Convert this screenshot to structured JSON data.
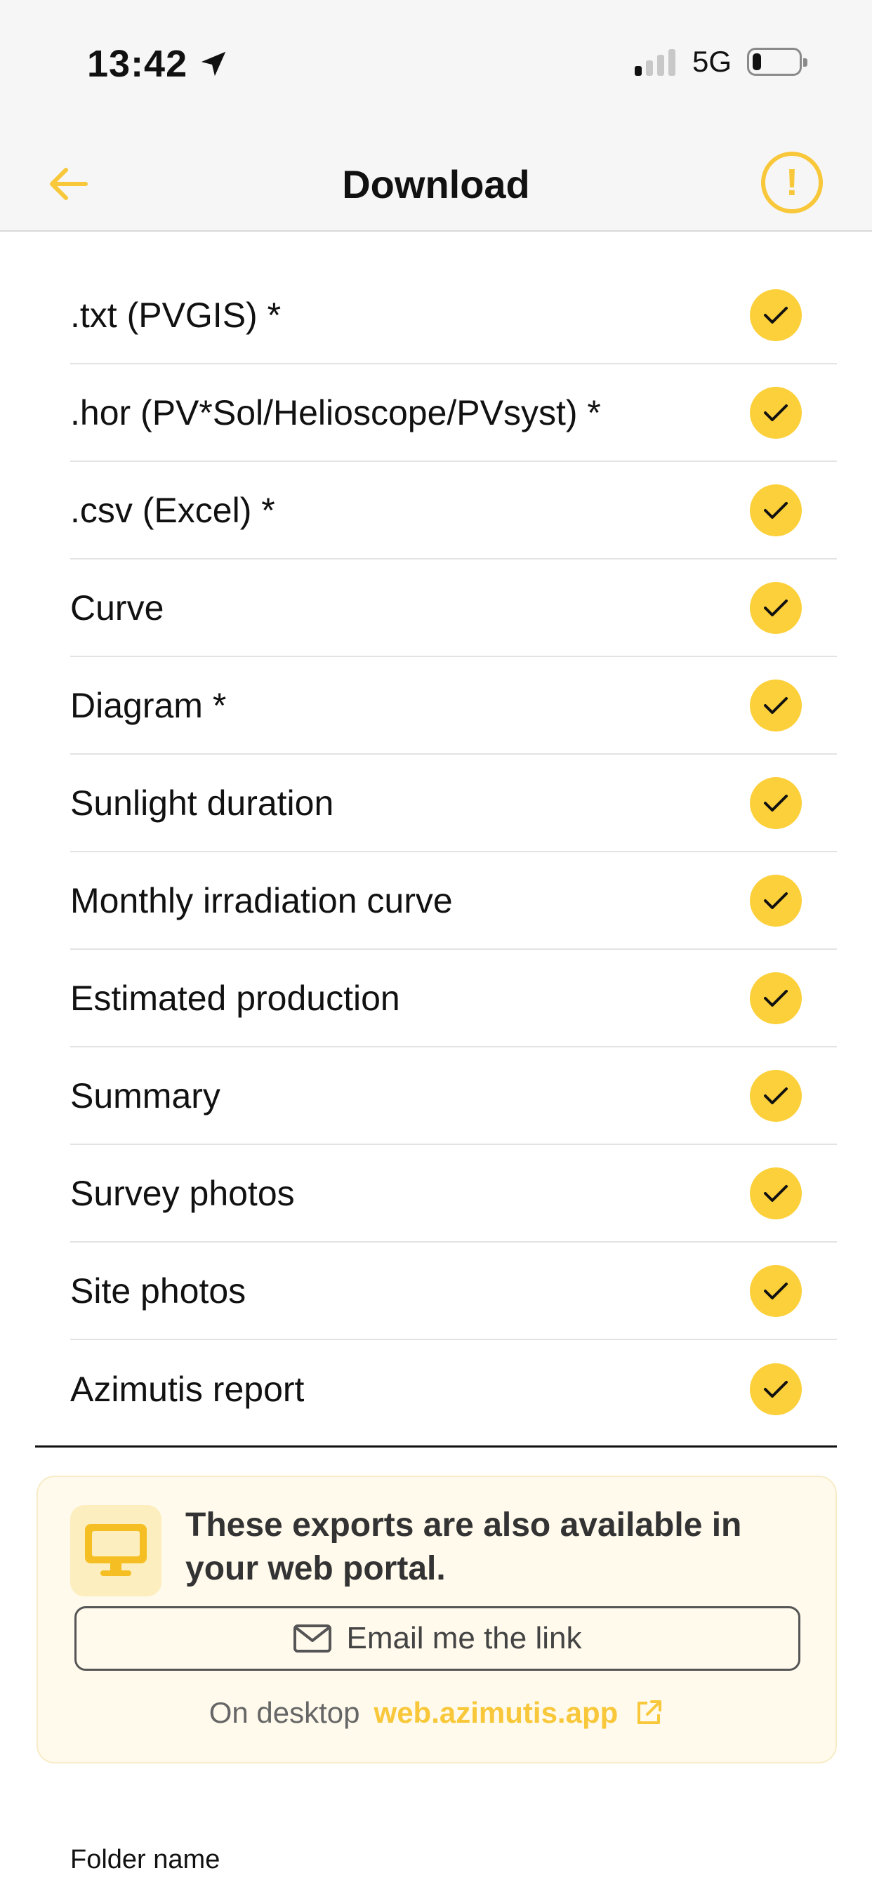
{
  "status_bar": {
    "time": "13:42",
    "network": "5G",
    "battery_level": 0.2,
    "signal_bars": 1
  },
  "nav": {
    "title": "Download",
    "back_icon": "arrow-left-icon",
    "info_icon": "exclamation-circle-icon",
    "alert_glyph": "!"
  },
  "list": {
    "items": [
      {
        "label": ".txt (PVGIS) *",
        "checked": true
      },
      {
        "label": ".hor (PV*Sol/Helioscope/PVsyst) *",
        "checked": true
      },
      {
        "label": ".csv (Excel) *",
        "checked": true
      },
      {
        "label": "Curve",
        "checked": true
      },
      {
        "label": "Diagram *",
        "checked": true
      },
      {
        "label": "Sunlight duration",
        "checked": true
      },
      {
        "label": "Monthly irradiation curve",
        "checked": true
      },
      {
        "label": "Estimated production",
        "checked": true
      },
      {
        "label": "Summary",
        "checked": true
      },
      {
        "label": "Survey photos",
        "checked": true
      },
      {
        "label": "Site photos",
        "checked": true
      },
      {
        "label": "Azimutis report",
        "checked": true
      }
    ]
  },
  "portal_card": {
    "message": "These exports are also available in your web portal.",
    "email_button_label": "Email me the link",
    "desktop_prefix": "On desktop",
    "desktop_link": "web.azimutis.app"
  },
  "folder": {
    "label": "Folder name"
  },
  "colors": {
    "accent": "#fcd03a",
    "card_bg": "#fffaec",
    "nav_bg": "#f6f6f6"
  }
}
